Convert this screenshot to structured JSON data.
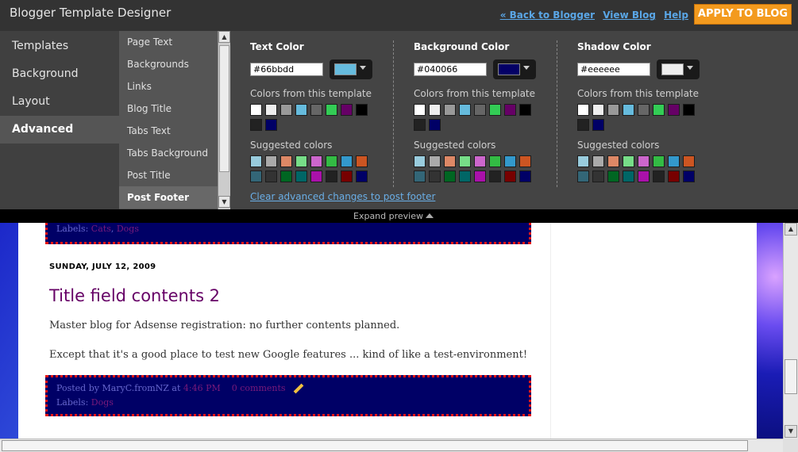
{
  "header": {
    "title": "Blogger Template Designer",
    "back_link": "« Back to Blogger",
    "view_blog": "View Blog",
    "help": "Help",
    "apply_button": "APPLY TO BLOG"
  },
  "left_menu": {
    "items": [
      "Templates",
      "Background",
      "Layout",
      "Advanced"
    ],
    "active": "Advanced"
  },
  "sub_menu": {
    "items": [
      "Page Text",
      "Backgrounds",
      "Links",
      "Blog Title",
      "Tabs Text",
      "Tabs Background",
      "Post Title",
      "Post Footer"
    ],
    "active": "Post Footer"
  },
  "color_columns": [
    {
      "title": "Text Color",
      "hex": "#66bbdd",
      "swatch": "#66bbdd",
      "template_label": "Colors from this template",
      "template_colors": [
        "#ffffff",
        "#eeeeee",
        "#999999",
        "#66bbdd",
        "#666666",
        "#33cc55",
        "#660066",
        "#000000",
        "#222222",
        "#000066"
      ],
      "suggested_label": "Suggested colors",
      "suggested_colors": [
        "#99ccdd",
        "#aaaaaa",
        "#dd8866",
        "#77dd88",
        "#cc66cc",
        "#33bb44",
        "#3399cc",
        "#cc5522",
        "#336677",
        "#333333",
        "#006622",
        "#006666",
        "#aa11aa",
        "#222222",
        "#770000",
        "#000066"
      ]
    },
    {
      "title": "Background Color",
      "hex": "#040066",
      "swatch": "#040066",
      "template_label": "Colors from this template",
      "template_colors": [
        "#ffffff",
        "#eeeeee",
        "#999999",
        "#66bbdd",
        "#666666",
        "#33cc55",
        "#660066",
        "#000000",
        "#222222",
        "#000066"
      ],
      "suggested_label": "Suggested colors",
      "suggested_colors": [
        "#99ccdd",
        "#aaaaaa",
        "#dd8866",
        "#77dd88",
        "#cc66cc",
        "#33bb44",
        "#3399cc",
        "#cc5522",
        "#336677",
        "#333333",
        "#006622",
        "#006666",
        "#aa11aa",
        "#222222",
        "#770000",
        "#000066"
      ]
    },
    {
      "title": "Shadow Color",
      "hex": "#eeeeee",
      "swatch": "#eeeeee",
      "template_label": "Colors from this template",
      "template_colors": [
        "#ffffff",
        "#eeeeee",
        "#999999",
        "#66bbdd",
        "#666666",
        "#33cc55",
        "#660066",
        "#000000",
        "#222222",
        "#000066"
      ],
      "suggested_label": "Suggested colors",
      "suggested_colors": [
        "#99ccdd",
        "#aaaaaa",
        "#dd8866",
        "#77dd88",
        "#cc66cc",
        "#33bb44",
        "#3399cc",
        "#cc5522",
        "#336677",
        "#333333",
        "#006622",
        "#006666",
        "#aa11aa",
        "#222222",
        "#770000",
        "#000066"
      ]
    }
  ],
  "clear_link": "Clear advanced changes to post footer",
  "expand_preview": "Expand preview",
  "preview": {
    "top_labels_prefix": "Labels:",
    "top_labels": [
      "Cats",
      "Dogs"
    ],
    "date_header": "SUNDAY, JULY 12, 2009",
    "post_title": "Title field contents 2",
    "body_paragraphs": [
      "Master blog for Adsense registration: no further contents planned.",
      "Except that it's a good place to test new Google features ... kind of like a test-environment!"
    ],
    "posted_by_prefix": "Posted by",
    "author": "MaryC.fromNZ",
    "at_word": "at",
    "time": "4:46 PM",
    "comments": "0 comments",
    "labels_prefix": "Labels:",
    "labels": [
      "Dogs"
    ]
  }
}
